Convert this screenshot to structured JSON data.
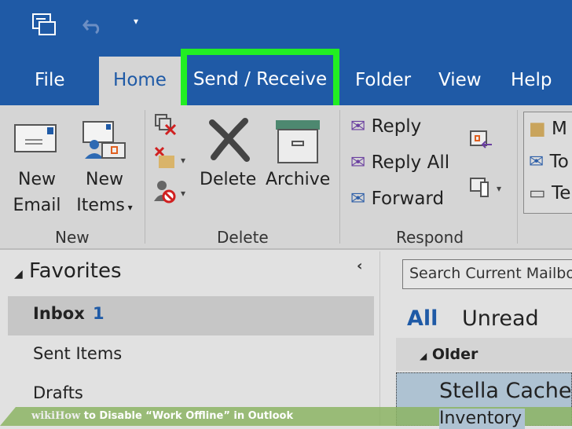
{
  "tabs": [
    "File",
    "Home",
    "Send / Receive",
    "Folder",
    "View",
    "Help"
  ],
  "ribbon": {
    "new": {
      "new_email": [
        "New",
        "Email"
      ],
      "new_items": [
        "New",
        "Items"
      ],
      "group": "New"
    },
    "delete": {
      "delete": "Delete",
      "archive": "Archive",
      "group": "Delete"
    },
    "respond": {
      "reply": "Reply",
      "reply_all": "Reply All",
      "forward": "Forward",
      "group": "Respond"
    },
    "quick_steps": [
      "M",
      "To",
      "Te"
    ]
  },
  "nav": {
    "favorites": "Favorites",
    "items": [
      {
        "label": "Inbox",
        "count": "1"
      },
      {
        "label": "Sent Items"
      },
      {
        "label": "Drafts"
      }
    ]
  },
  "mail": {
    "search_placeholder": "Search Current Mailbox",
    "filters": [
      "All",
      "Unread"
    ],
    "group": "Older",
    "message": {
      "sender": "Stella Cachet",
      "subject": "Inventory"
    }
  },
  "watermark": {
    "brand": "wikiHow",
    "text": "to Disable “Work Offline” in Outlook"
  },
  "colors": {
    "accent": "#1f5aa6",
    "highlight": "#22ee22"
  }
}
